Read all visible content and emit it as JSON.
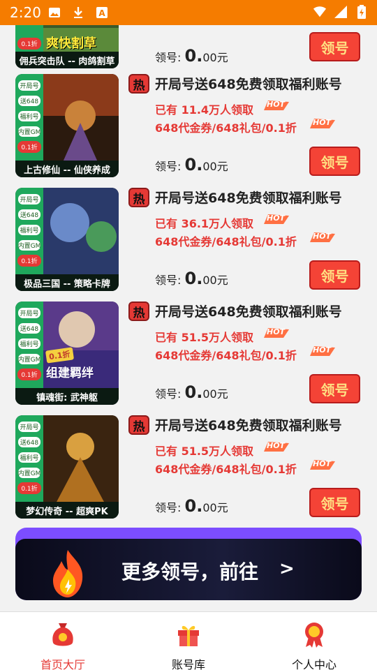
{
  "status_bar": {
    "time": "2:20",
    "left_icons": [
      "image-icon",
      "download-icon",
      "text-a-icon"
    ],
    "right_icons": [
      "wifi-icon",
      "signal-icon",
      "battery-icon"
    ],
    "background": "#f57c00"
  },
  "cards": [
    {
      "caption": "佣兵突击队 -- 肉鸽割草",
      "art_text": "爽快割草",
      "tags": [
        "0.1折"
      ],
      "price_label": "领号:",
      "price_int": "0.",
      "price_dec": "00元",
      "claim_label": "领号"
    },
    {
      "caption": "上古修仙 -- 仙侠养成",
      "tags": [
        "开局号",
        "送648",
        "福利号",
        "内置GM",
        "0.1折"
      ],
      "hot_label": "热",
      "title": "开局号送648免费领取福利账号",
      "claimed": "已有 11.4万人领取",
      "benefits": "648代金券/648礼包/0.1折",
      "hot_tag": "HOT",
      "price_label": "领号:",
      "price_int": "0.",
      "price_dec": "00元",
      "claim_label": "领号"
    },
    {
      "caption": "极品三国 -- 策略卡牌",
      "tags": [
        "开局号",
        "送648",
        "福利号",
        "内置GM",
        "0.1折"
      ],
      "hot_label": "热",
      "title": "开局号送648免费领取福利账号",
      "claimed": "已有 36.1万人领取",
      "benefits": "648代金券/648礼包/0.1折",
      "hot_tag": "HOT",
      "price_label": "领号:",
      "price_int": "0.",
      "price_dec": "00元",
      "claim_label": "领号"
    },
    {
      "caption": "镇魂街: 武神躯",
      "art_text": "组建羁绊",
      "art_badge": "0.1折",
      "tags": [
        "开局号",
        "送648",
        "福利号",
        "内置GM",
        "0.1折"
      ],
      "hot_label": "热",
      "title": "开局号送648免费领取福利账号",
      "claimed": "已有 51.5万人领取",
      "benefits": "648代金券/648礼包/0.1折",
      "hot_tag": "HOT",
      "price_label": "领号:",
      "price_int": "0.",
      "price_dec": "00元",
      "claim_label": "领号"
    },
    {
      "caption": "梦幻传奇 -- 超爽PK",
      "tags": [
        "开局号",
        "送648",
        "福利号",
        "内置GM",
        "0.1折"
      ],
      "hot_label": "热",
      "title": "开局号送648免费领取福利账号",
      "claimed": "已有 51.5万人领取",
      "benefits": "648代金券/648礼包/0.1折",
      "hot_tag": "HOT",
      "price_label": "领号:",
      "price_int": "0.",
      "price_dec": "00元",
      "claim_label": "领号"
    }
  ],
  "more_banner": {
    "text": "更多领号，前往",
    "arrow": ">"
  },
  "bottom_nav": [
    {
      "label": "首页大厅",
      "icon": "money-bag-icon",
      "active": true
    },
    {
      "label": "账号库",
      "icon": "gift-box-icon",
      "active": false
    },
    {
      "label": "个人中心",
      "icon": "award-medal-icon",
      "active": false
    }
  ],
  "colors": {
    "accent_red": "#e53935",
    "tag_green": "#1fa85c",
    "status_orange": "#f57c00",
    "banner_purple": "#7c4dff"
  }
}
